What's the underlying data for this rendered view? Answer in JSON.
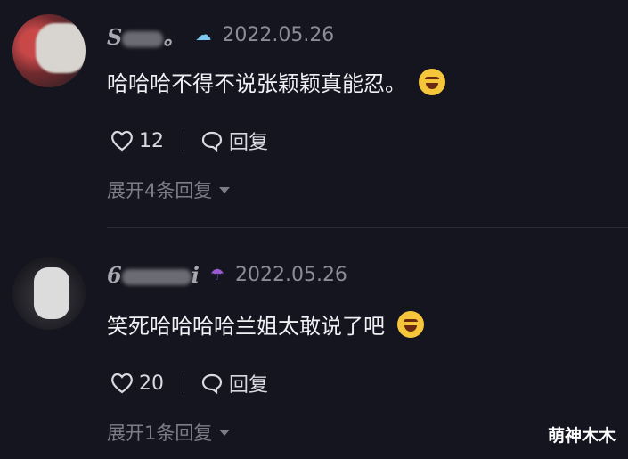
{
  "comments": [
    {
      "username": "S",
      "username_tail": "。",
      "badge_icon": "cloud-icon",
      "date": "2022.05.26",
      "text": "哈哈哈不得不说张颖颖真能忍。",
      "emoji": "laughing-tears-emoji",
      "likes": "12",
      "reply_label": "回复",
      "expand_label": "展开4条回复"
    },
    {
      "username": "6",
      "username_tail": "i",
      "badge_icon": "umbrella-icon",
      "date": "2022.05.26",
      "text": "笑死哈哈哈哈兰姐太敢说了吧",
      "emoji": "grinning-sweat-emoji",
      "likes": "20",
      "reply_label": "回复",
      "expand_label": "展开1条回复"
    }
  ],
  "watermark": "萌神木木",
  "colors": {
    "background": "#15151f",
    "text": "#f0f0f4",
    "muted": "#8c8c96"
  }
}
